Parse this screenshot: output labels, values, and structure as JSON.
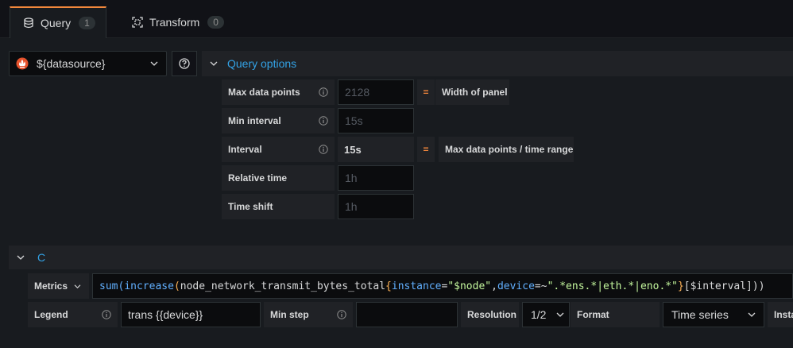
{
  "tabs": [
    {
      "label": "Query",
      "count": "1"
    },
    {
      "label": "Transform",
      "count": "0"
    }
  ],
  "datasource": {
    "value": "${datasource}"
  },
  "query_options": {
    "title": "Query options",
    "max_data_points": {
      "label": "Max data points",
      "placeholder": "2128",
      "equals": "=",
      "note": "Width of panel"
    },
    "min_interval": {
      "label": "Min interval",
      "placeholder": "15s"
    },
    "interval": {
      "label": "Interval",
      "value": "15s",
      "equals": "=",
      "note": "Max data points / time range"
    },
    "relative_time": {
      "label": "Relative time",
      "placeholder": "1h"
    },
    "time_shift": {
      "label": "Time shift",
      "placeholder": "1h"
    }
  },
  "query_row": {
    "name": "C",
    "metrics_label": "Metrics",
    "expr": {
      "p1": "sum",
      "p2": "(",
      "p3": "increase",
      "p4": "(",
      "p5": "node_network_transmit_bytes_total",
      "p6": "{",
      "p7": "instance",
      "p8": "=",
      "p9": "\"$node\"",
      "p10": ",",
      "p11": "device",
      "p12": "=~",
      "p13": "\".*ens.*|eth.*|eno.*\"",
      "p14": "}",
      "p15": "[$interval]",
      "p16": "))"
    },
    "legend_label": "Legend",
    "legend_value": "trans {{device}}",
    "min_step_label": "Min step",
    "min_step_value": "",
    "resolution_label": "Resolution",
    "resolution_value": "1/2",
    "format_label": "Format",
    "format_value": "Time series",
    "instant_label": "Instan"
  },
  "colors": {
    "accent": "#33a2e5",
    "tab_active": "#f2873c",
    "equals": "#f2873c"
  }
}
